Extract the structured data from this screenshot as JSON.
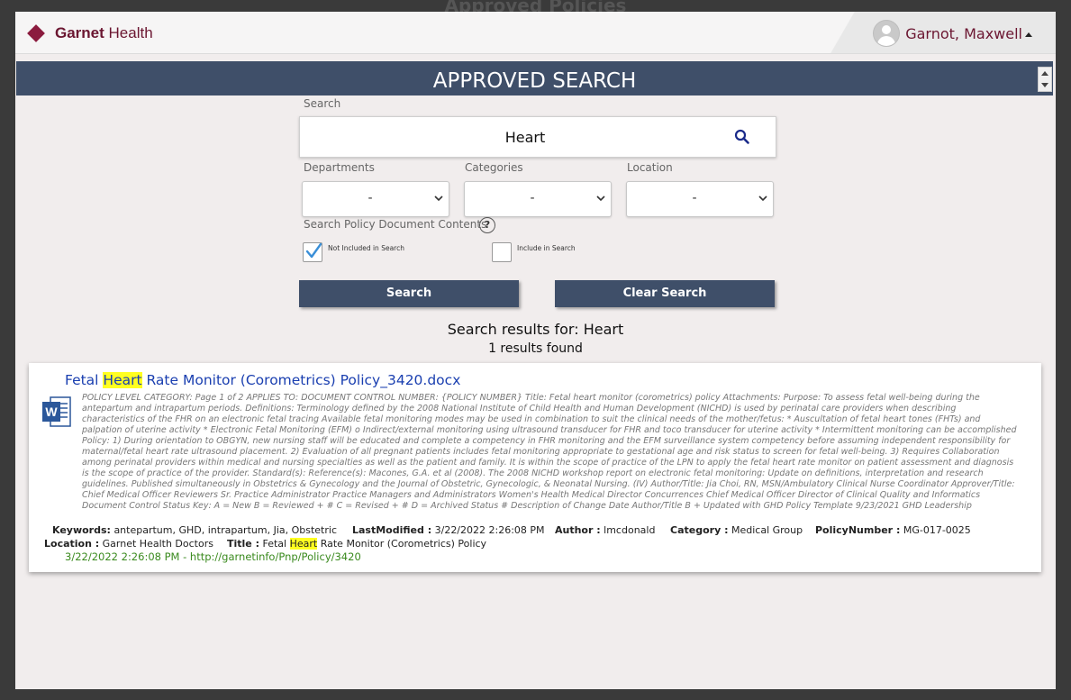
{
  "background": {
    "title": "Approved Policies"
  },
  "header": {
    "logo_bold": "Garnet",
    "logo_rest": " Health",
    "user_name": "Garnot, Maxwell"
  },
  "banner": {
    "title": "APPROVED SEARCH"
  },
  "search": {
    "label": "Search",
    "value": "Heart",
    "icon": "search-icon"
  },
  "filters": {
    "departments": {
      "label": "Departments",
      "value": "-"
    },
    "categories": {
      "label": "Categories",
      "value": "-"
    },
    "location": {
      "label": "Location",
      "value": "-"
    }
  },
  "contents_search": {
    "label": "Search Policy Document Contents",
    "help": "?",
    "not_included_label": "Not Included in Search",
    "not_included_checked": true,
    "include_label": "Include in Search",
    "include_checked": false
  },
  "buttons": {
    "search": "Search",
    "clear": "Clear Search"
  },
  "results": {
    "heading": "Search results for: Heart",
    "count": "1 results found",
    "items": [
      {
        "title_before": "Fetal ",
        "title_highlight": "Heart",
        "title_after": " Rate Monitor (Corometrics) Policy_3420.docx",
        "excerpt": "POLICY LEVEL CATEGORY: Page 1 of 2 APPLIES TO: DOCUMENT CONTROL NUMBER: {POLICY NUMBER} Title: Fetal heart monitor (corometrics) policy Attachments: Purpose: To assess fetal well-being during the antepartum and intrapartum periods. Definitions: Terminology defined by the 2008 National Institute of Child Health and Human Development (NICHD) is used by perinatal care providers when describing characteristics of the FHR on an electronic fetal tracing Available fetal monitoring modes may be used in combination to suit the clinical needs of the mother/fetus: * Auscultation of fetal heart tones (FHTs) and palpation of uterine activity * Electronic Fetal Monitoring (EFM) o Indirect/external monitoring using ultrasound transducer for FHR and toco transducer for uterine activity * Intermittent monitoring can be accomplished Policy: 1) During orientation to OBGYN, new nursing staff will be educated and complete a competency in FHR monitoring and the EFM surveillance system competency before assuming independent responsibility for maternal/fetal heart rate ultrasound placement. 2) Evaluation of all pregnant patients includes fetal monitoring appropriate to gestational age and risk status to screen for fetal well-being. 3) Requires Collaboration among perinatal providers within medical and nursing specialties as well as the patient and family. It is within the scope of practice of the LPN to apply the fetal heart rate monitor on patient assessment and diagnosis is the scope of practice of the provider. Standard(s): Reference(s): Macones, G.A. et al (2008). The 2008 NICHD workshop report on electronic fetal monitoring: Update on definitions, interpretation and research guidelines. Published simultaneously in Obstetrics & Gynecology and the Journal of Obstetric, Gynecologic, & Neonatal Nursing. (IV) Author/Title: Jia Choi, RN, MSN/Ambulatory Clinical Nurse Coordinator Approver/Title: Chief Medical Officer Reviewers Sr. Practice Administrator Practice Managers and Administrators Women's Health Medical Director Concurrences Chief Medical Officer Director of Clinical Quality and Informatics Document Control Status Key: A = New B = Reviewed + # C = Revised + # D = Archived Status # Description of Change Date Author/Title B + Updated with GHD Policy Template 9/23/2021 GHD Leadership",
        "keywords_label": "Keywords:",
        "keywords": "antepartum, GHD, intrapartum, Jia, Obstetric",
        "last_modified_label": "LastModified :",
        "last_modified": "3/22/2022 2:26:08 PM",
        "author_label": "Author :",
        "author": "lmcdonald",
        "category_label": "Category :",
        "category": "Medical Group",
        "policy_number_label": "PolicyNumber :",
        "policy_number": "MG-017-0025",
        "location_label": "Location :",
        "location": "Garnet Health Doctors",
        "title_label": "Title :",
        "title_field_before": "Fetal ",
        "title_field_highlight": "Heart",
        "title_field_after": " Rate Monitor (Corometrics) Policy",
        "url_line": "3/22/2022 2:26:08 PM - http://garnetinfo/Pnp/Policy/3420"
      }
    ]
  },
  "colors": {
    "banner": "#3f4f69",
    "brand": "#8b1b3e",
    "link": "#1a3fb0",
    "url": "#3a8a1e",
    "highlight": "#ffff20"
  }
}
